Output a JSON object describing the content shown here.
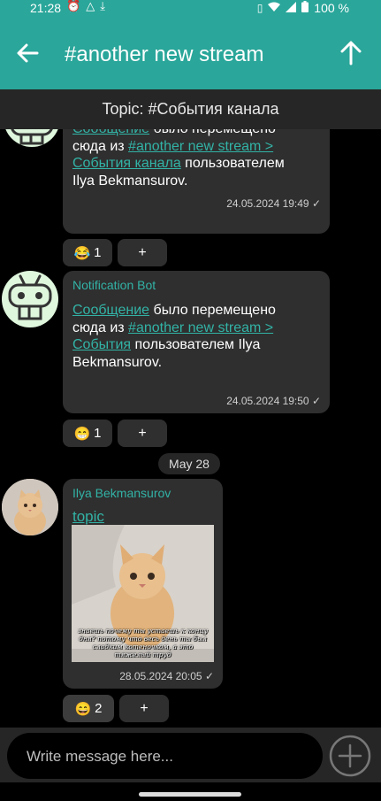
{
  "status": {
    "time": "21:28",
    "battery_text": "100 %"
  },
  "appbar": {
    "title": "#another new stream"
  },
  "topic": {
    "label": "Topic: #События канала"
  },
  "messages": [
    {
      "sender": "",
      "text_parts": [
        {
          "text": "Сообщение",
          "link": true
        },
        {
          "text": " было перемещено сюда из ",
          "link": false
        },
        {
          "text": "#another new stream > События канала",
          "link": true
        },
        {
          "text": " пользователем Ilya Bekmansurov.",
          "link": false
        }
      ],
      "time": "24.05.2024 19:49 ✓",
      "reaction": {
        "emoji": "😂",
        "count": "1"
      },
      "add_label": "+"
    },
    {
      "sender": "Notification Bot",
      "text_parts": [
        {
          "text": "Сообщение",
          "link": true
        },
        {
          "text": " было перемещено сюда из ",
          "link": false
        },
        {
          "text": "#another new stream > События",
          "link": true
        },
        {
          "text": " пользователем Ilya Bekmansurov.",
          "link": false
        }
      ],
      "time": "24.05.2024 19:50 ✓",
      "reaction": {
        "emoji": "😁",
        "count": "1"
      },
      "add_label": "+"
    },
    {
      "sender": "Ilya Bekmansurov",
      "link_text": "topic",
      "image_caption": "знаешь почему ты устаешь к концу дня? потому что весь день ты был сладким котеночком, а это тяжелый труд",
      "time": "28.05.2024 20:05 ✓",
      "reaction": {
        "emoji": "😄",
        "count": "2"
      },
      "add_label": "+"
    }
  ],
  "date_separator": "May 28",
  "composer": {
    "placeholder": "Write message here..."
  },
  "colors": {
    "accent": "#2aa69a",
    "link": "#32b3a6",
    "bubble": "#2f2f2f"
  }
}
